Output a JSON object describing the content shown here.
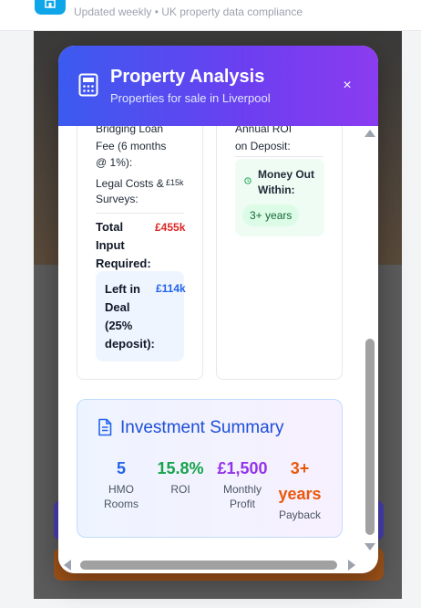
{
  "topbar": {
    "tagline": "Updated weekly • UK property data compliance"
  },
  "modal": {
    "title": "Property Analysis",
    "subtitle": "Properties for sale in Liverpool",
    "close_icon": "×"
  },
  "left_card": {
    "bridging_label": "Bridging Loan Fee (6 months @ 1%):",
    "bridging_line1": "Bridging Loan",
    "bridging_line2": "Fee (6 months",
    "bridging_line3": "@ 1%):",
    "legal_label_1": "Legal Costs &",
    "legal_label_2": "Surveys:",
    "legal_value": "£15k",
    "total_label_1": "Total",
    "total_label_2": "Input",
    "total_label_3": "Required:",
    "total_value": "£455k",
    "left_label_1": "Left in",
    "left_label_2": "Deal",
    "left_label_3": "(25%",
    "left_label_4": "deposit):",
    "left_value": "£114k"
  },
  "right_card": {
    "roi_label_1": "Annual ROI",
    "roi_label_2": "on Deposit:",
    "money_out_1": "Money Out",
    "money_out_2": "Within:",
    "money_out_value": "3+ years"
  },
  "summary": {
    "title": "Investment Summary",
    "stats": [
      {
        "value": "5",
        "label_1": "HMO",
        "label_2": "Rooms",
        "color": "#2563eb"
      },
      {
        "value": "15.8%",
        "label_1": "ROI",
        "label_2": "",
        "color": "#16a34a"
      },
      {
        "value": "£1,500",
        "label_1": "Monthly",
        "label_2": "Profit",
        "color": "#9333ea"
      },
      {
        "value_1": "3+",
        "value_2": "years",
        "label_1": "Payback",
        "color": "#ea580c"
      }
    ]
  },
  "colors": {
    "header_gradient_start": "#3b5bf0",
    "header_gradient_end": "#8b3cf0",
    "total_red": "#dc2626",
    "left_blue": "#2563eb"
  }
}
